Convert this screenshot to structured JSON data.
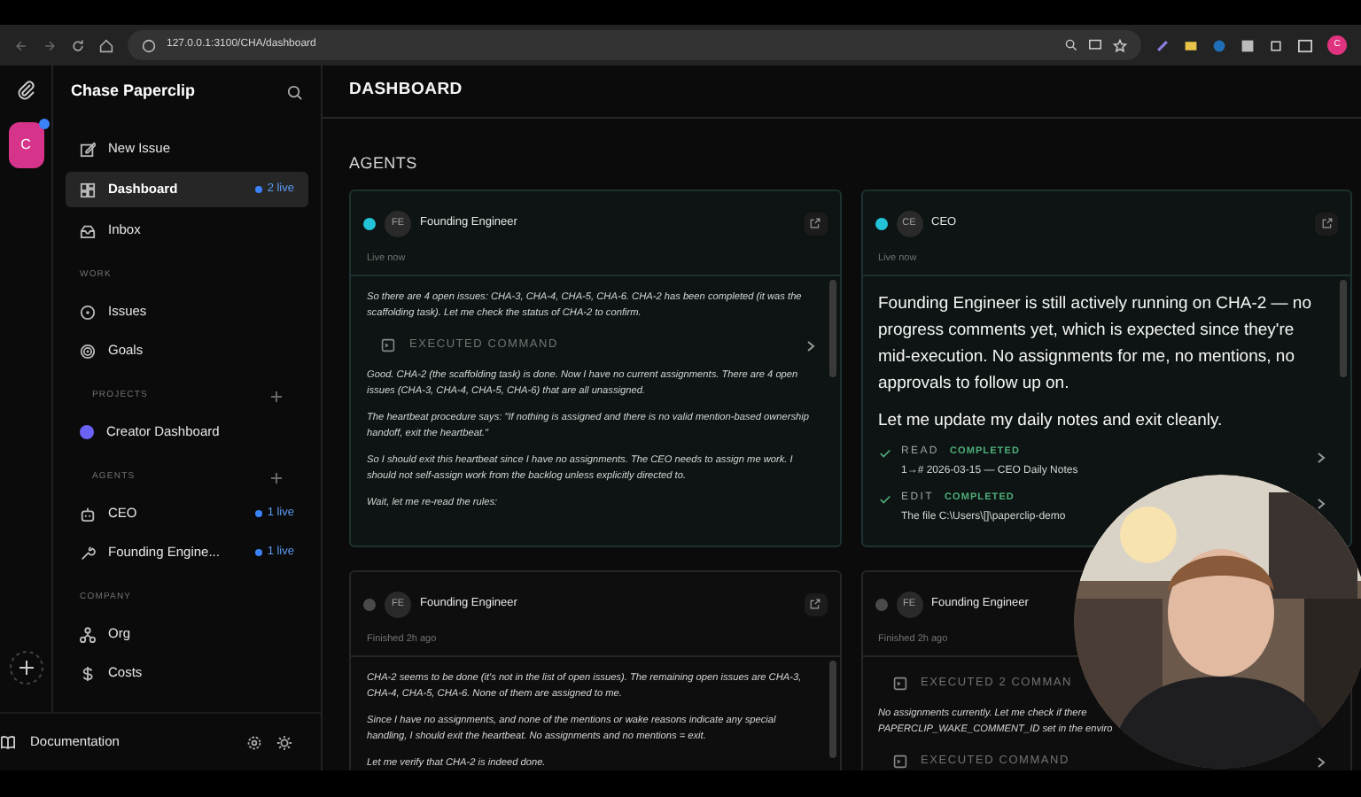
{
  "browser": {
    "url": "127.0.0.1:3100/CHA/dashboard",
    "profile_initial": "C"
  },
  "rail": {
    "company_initial": "C",
    "has_notification": true
  },
  "sidebar": {
    "title": "Chase Paperclip",
    "nav": [
      {
        "label": "New Issue",
        "selected": false
      },
      {
        "label": "Dashboard",
        "selected": true,
        "badge": "2 live"
      },
      {
        "label": "Inbox",
        "selected": false
      }
    ],
    "sections": [
      {
        "heading": "WORK",
        "addable": false,
        "items": [
          {
            "label": "Issues"
          },
          {
            "label": "Goals"
          }
        ]
      },
      {
        "heading": "PROJECTS",
        "addable": true,
        "items": [
          {
            "label": "Creator Dashboard",
            "color": "#6b63f5"
          }
        ]
      },
      {
        "heading": "AGENTS",
        "addable": true,
        "items": [
          {
            "label": "CEO",
            "badge": "1 live"
          },
          {
            "label": "Founding Engine...",
            "badge": "1 live"
          }
        ]
      },
      {
        "heading": "COMPANY",
        "addable": false,
        "items": [
          {
            "label": "Org"
          },
          {
            "label": "Costs"
          }
        ]
      }
    ],
    "footer": {
      "label": "Documentation"
    }
  },
  "main": {
    "title": "DASHBOARD",
    "section": "AGENTS",
    "cards": [
      {
        "initials": "FE",
        "name": "Founding Engineer",
        "live": true,
        "status": "Live now",
        "entries": [
          {
            "kind": "thinking",
            "lines": [
              "So there are 4 open issues: CHA-3, CHA-4, CHA-5, CHA-6. CHA-2 has been completed (it was the scaffolding task). Let me check the status of CHA-2 to confirm."
            ]
          },
          {
            "kind": "command",
            "label": "EXECUTED COMMAND"
          },
          {
            "kind": "thinking",
            "lines": [
              "Good. CHA-2 (the scaffolding task) is done. Now I have no current assignments. There are 4 open issues (CHA-3, CHA-4, CHA-5, CHA-6) that are all unassigned."
            ]
          },
          {
            "kind": "thinking",
            "lines": [
              "The heartbeat procedure says: \"If nothing is assigned and there is no valid mention-based ownership handoff, exit the heartbeat.\""
            ]
          },
          {
            "kind": "thinking",
            "lines": [
              "So I should exit this heartbeat since I have no assignments. The CEO needs to assign me work. I should not self-assign work from the backlog unless explicitly directed to."
            ]
          },
          {
            "kind": "thinking",
            "lines": [
              "Wait, let me re-read the rules:"
            ]
          }
        ]
      },
      {
        "initials": "CE",
        "name": "CEO",
        "live": true,
        "status": "Live now",
        "entries": [
          {
            "kind": "message",
            "lines": [
              "Founding Engineer is still actively running on CHA-2 — no progress comments yet, which is expected since they're mid-execution. No assignments for me, no mentions, no approvals to follow up on."
            ]
          },
          {
            "kind": "message",
            "lines": [
              "Let me update my daily notes and exit cleanly."
            ]
          },
          {
            "kind": "tool",
            "action": "READ",
            "status": "COMPLETED",
            "detail": "1→# 2026-03-15 — CEO Daily Notes"
          },
          {
            "kind": "tool",
            "action": "EDIT",
            "status": "COMPLETED",
            "detail": "The file C:\\Users\\[]\\paperclip-demo"
          }
        ]
      },
      {
        "initials": "FE",
        "name": "Founding Engineer",
        "live": false,
        "status": "Finished 2h ago",
        "entries": [
          {
            "kind": "thinking",
            "lines": [
              "CHA-2 seems to be done (it's not in the list of open issues). The remaining open issues are CHA-3, CHA-4, CHA-5, CHA-6. None of them are assigned to me."
            ]
          },
          {
            "kind": "thinking",
            "lines": [
              "Since I have no assignments, and none of the mentions or wake reasons indicate any special handling, I should exit the heartbeat. No assignments and no mentions = exit."
            ]
          },
          {
            "kind": "thinking",
            "lines": [
              "Let me verify that CHA-2 is indeed done."
            ]
          }
        ]
      },
      {
        "initials": "FE",
        "name": "Founding Engineer",
        "live": false,
        "status": "Finished 2h ago",
        "entries": [
          {
            "kind": "command",
            "label": "EXECUTED 2 COMMAN"
          },
          {
            "kind": "thinking",
            "lines": [
              "No assignments currently. Let me check if there",
              "PAPERCLIP_WAKE_COMMENT_ID set in the enviro"
            ]
          },
          {
            "kind": "command",
            "label": "EXECUTED COMMAND"
          }
        ]
      }
    ]
  }
}
